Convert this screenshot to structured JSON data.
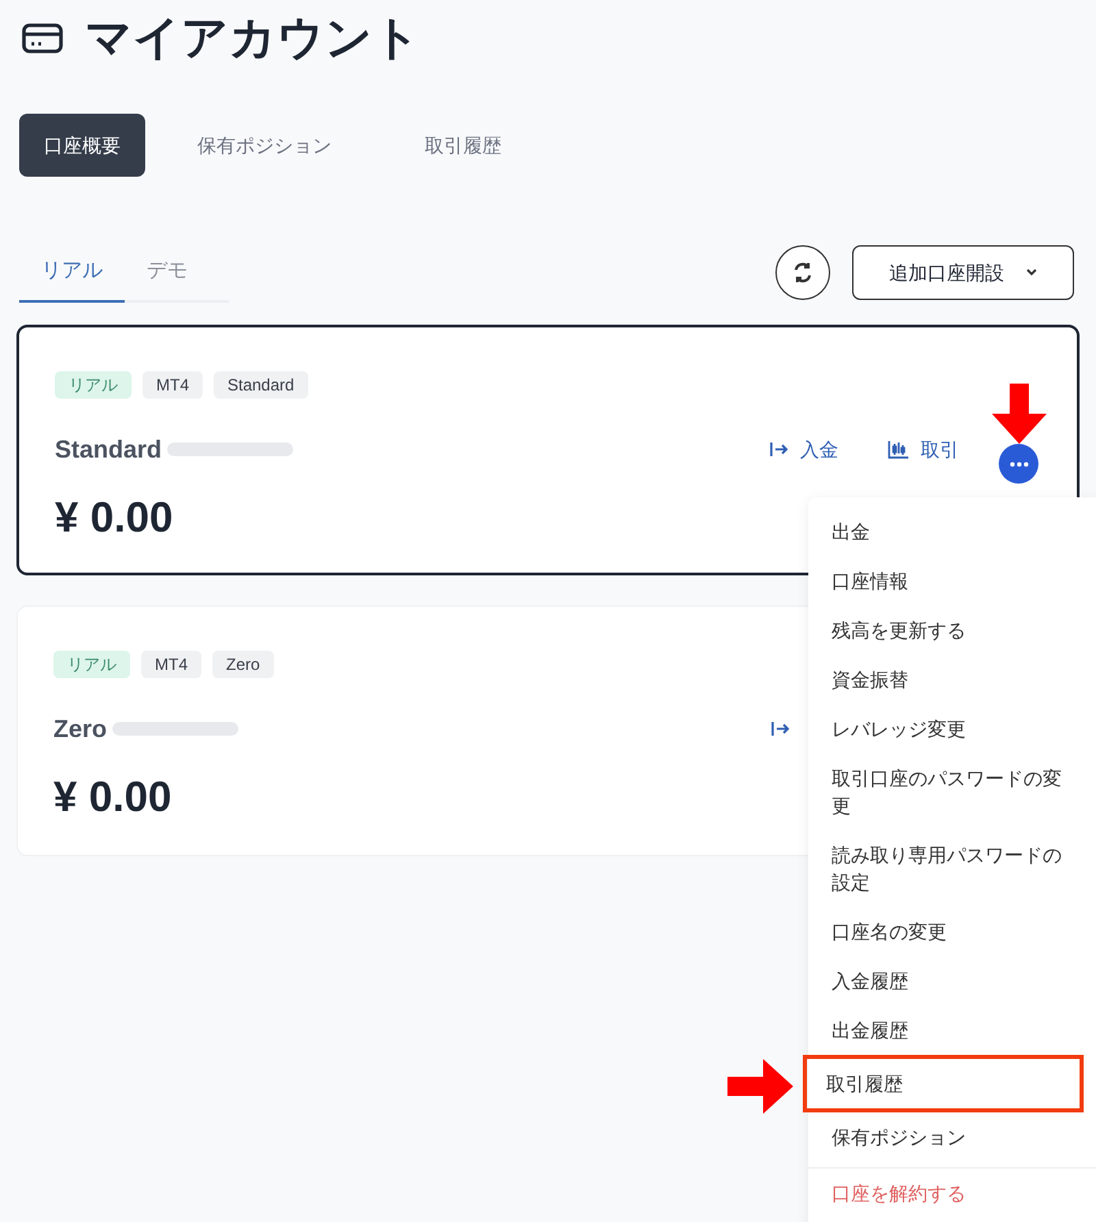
{
  "title": "マイアカウント",
  "tabs": [
    {
      "label": "口座概要",
      "selected": true
    },
    {
      "label": "保有ポジション",
      "selected": false
    },
    {
      "label": "取引履歴",
      "selected": false
    }
  ],
  "subtabs": [
    {
      "label": "リアル",
      "selected": true
    },
    {
      "label": "デモ",
      "selected": false
    }
  ],
  "open_account_button": "追加口座開設",
  "cards": [
    {
      "focused": true,
      "tags": [
        {
          "label": "リアル",
          "kind": "type"
        },
        {
          "label": "MT4",
          "kind": "plain"
        },
        {
          "label": "Standard",
          "kind": "plain"
        }
      ],
      "name": "Standard",
      "balance": "¥ 0.00",
      "actions": [
        {
          "kind": "deposit",
          "label": "入金"
        },
        {
          "kind": "trade",
          "label": "取引"
        }
      ],
      "menu_open": true
    },
    {
      "focused": false,
      "tags": [
        {
          "label": "リアル",
          "kind": "type"
        },
        {
          "label": "MT4",
          "kind": "plain"
        },
        {
          "label": "Zero",
          "kind": "plain"
        }
      ],
      "name": "Zero",
      "balance": "¥ 0.00",
      "actions": [
        {
          "kind": "deposit"
        }
      ],
      "menu_open": false
    }
  ],
  "menu": [
    {
      "label": "出金",
      "kind": "normal",
      "highlighted": false
    },
    {
      "label": "口座情報",
      "kind": "normal",
      "highlighted": false
    },
    {
      "label": "残高を更新する",
      "kind": "normal",
      "highlighted": false
    },
    {
      "label": "資金振替",
      "kind": "normal",
      "highlighted": false
    },
    {
      "label": "レバレッジ変更",
      "kind": "normal",
      "highlighted": false
    },
    {
      "label": "取引口座のパスワードの変更",
      "kind": "normal",
      "highlighted": false
    },
    {
      "label": "読み取り専用パスワードの設定",
      "kind": "normal",
      "highlighted": false
    },
    {
      "label": "口座名の変更",
      "kind": "normal",
      "highlighted": false
    },
    {
      "label": "入金履歴",
      "kind": "normal",
      "highlighted": false
    },
    {
      "label": "出金履歴",
      "kind": "normal",
      "highlighted": false
    },
    {
      "label": "取引履歴",
      "kind": "normal",
      "highlighted": true
    },
    {
      "label": "保有ポジション",
      "kind": "normal",
      "highlighted": false
    },
    {
      "label": "口座を解約する",
      "kind": "danger",
      "highlighted": false
    }
  ]
}
